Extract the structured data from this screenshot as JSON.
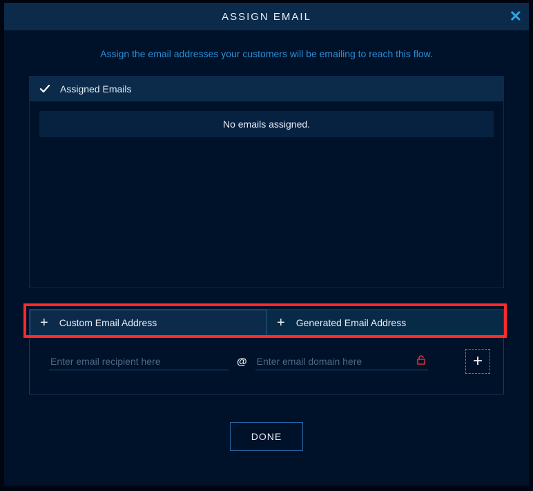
{
  "dialog": {
    "title": "ASSIGN EMAIL",
    "subtitle": "Assign the email addresses your customers will be emailing to reach this flow."
  },
  "assigned": {
    "header": "Assigned Emails",
    "empty_message": "No emails assigned."
  },
  "tabs": {
    "custom": "Custom Email Address",
    "generated": "Generated Email Address"
  },
  "inputs": {
    "recipient_placeholder": "Enter email recipient here",
    "at": "@",
    "domain_placeholder": "Enter email domain here"
  },
  "buttons": {
    "done": "DONE"
  }
}
